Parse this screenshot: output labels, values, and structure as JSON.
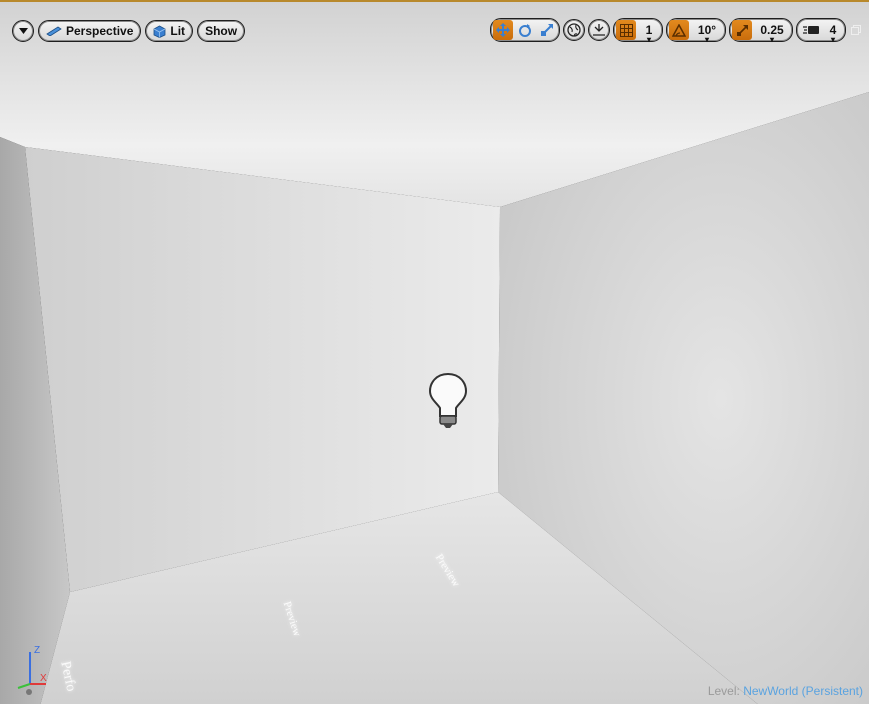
{
  "toolbar": {
    "dropdown_icon": "chevron-down-icon",
    "perspective_label": "Perspective",
    "lit_label": "Lit",
    "show_label": "Show",
    "translate_icon": "translate-icon",
    "rotate_icon": "rotate-icon",
    "scale_icon": "scale-icon",
    "world_icon": "globe-icon",
    "surface_snap_icon": "surface-snap-icon",
    "grid_snap_icon": "grid-icon",
    "grid_value": "1",
    "rotation_snap_icon": "rotation-snap-icon",
    "rotation_value": "10°",
    "scale_snap_icon": "scale-snap-icon",
    "scale_value": "0.25",
    "camera_speed_icon": "camera-speed-icon",
    "camera_speed_value": "4",
    "maximize_icon": "maximize-icon"
  },
  "scene": {
    "floor_text_1": "Preview",
    "floor_text_2": "Preview",
    "floor_text_3": "Perfo"
  },
  "status": {
    "level_prefix": "Level:",
    "level_name": "NewWorld (Persistent)"
  },
  "gizmo": {
    "z_label": "Z",
    "x_label": "X"
  },
  "colors": {
    "accent": "#d97a12",
    "level_name": "#5aa3e0",
    "frame": "#b8892c"
  }
}
